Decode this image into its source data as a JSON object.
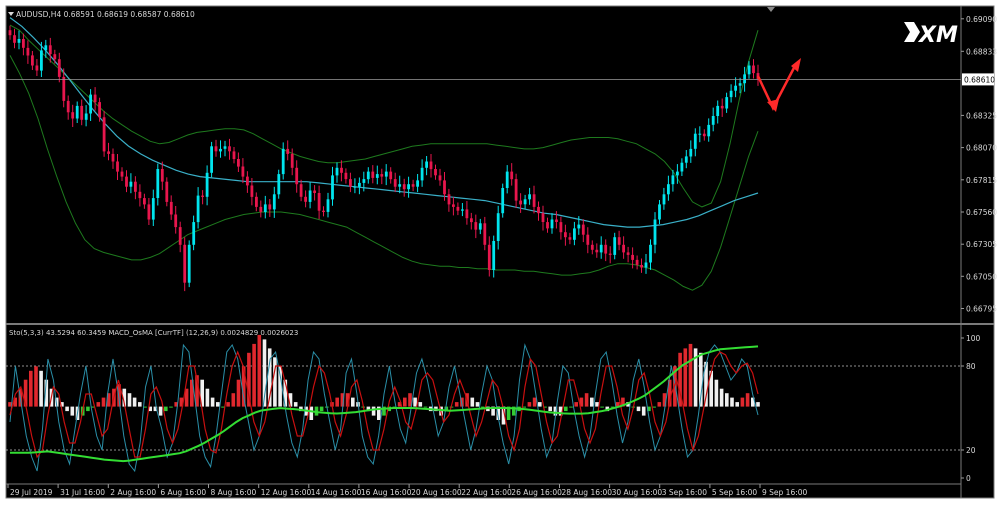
{
  "chart_data": {
    "type": "candlestick",
    "main_panel": {
      "title": "AUDUSD,H4  0.68591 0.68619 0.68587 0.68610",
      "current_price": 0.6861,
      "current_price_label": "0.68610",
      "ylim": [
        0.6672,
        0.6916
      ],
      "y_ticks": [
        "0.69090",
        "0.68833",
        "0.68325",
        "0.68070",
        "0.67815",
        "0.67560",
        "0.67305",
        "0.67050",
        "0.66795"
      ],
      "closes": [
        0.6896,
        0.689,
        0.6893,
        0.6886,
        0.688,
        0.6872,
        0.6868,
        0.6884,
        0.6888,
        0.6881,
        0.6877,
        0.6863,
        0.6844,
        0.6835,
        0.683,
        0.684,
        0.6829,
        0.6834,
        0.6849,
        0.6843,
        0.6831,
        0.6804,
        0.6802,
        0.6796,
        0.6788,
        0.6784,
        0.6776,
        0.678,
        0.6772,
        0.6767,
        0.6762,
        0.675,
        0.6767,
        0.679,
        0.678,
        0.6764,
        0.6754,
        0.6744,
        0.673,
        0.67,
        0.673,
        0.6748,
        0.6769,
        0.6768,
        0.6787,
        0.6808,
        0.6804,
        0.6806,
        0.6808,
        0.6804,
        0.6798,
        0.6792,
        0.6784,
        0.6777,
        0.6768,
        0.676,
        0.6756,
        0.6762,
        0.6758,
        0.677,
        0.6786,
        0.6806,
        0.6802,
        0.6791,
        0.6778,
        0.6768,
        0.6764,
        0.6773,
        0.6771,
        0.6757,
        0.6756,
        0.6766,
        0.6785,
        0.6791,
        0.6787,
        0.6782,
        0.6776,
        0.6776,
        0.6779,
        0.6782,
        0.6788,
        0.6783,
        0.6786,
        0.6784,
        0.6788,
        0.6782,
        0.6776,
        0.6778,
        0.6774,
        0.6778,
        0.6776,
        0.6781,
        0.6791,
        0.6796,
        0.679,
        0.6785,
        0.6781,
        0.677,
        0.6762,
        0.676,
        0.6757,
        0.6758,
        0.6751,
        0.6748,
        0.6742,
        0.6747,
        0.673,
        0.671,
        0.6733,
        0.6755,
        0.6775,
        0.6788,
        0.6782,
        0.6765,
        0.6762,
        0.6766,
        0.677,
        0.676,
        0.6755,
        0.6748,
        0.6743,
        0.675,
        0.6748,
        0.674,
        0.6736,
        0.6734,
        0.6743,
        0.6746,
        0.6738,
        0.673,
        0.6726,
        0.6724,
        0.673,
        0.6723,
        0.6722,
        0.6736,
        0.673,
        0.6724,
        0.6722,
        0.6718,
        0.6714,
        0.6712,
        0.6716,
        0.673,
        0.675,
        0.6762,
        0.677,
        0.6778,
        0.6785,
        0.6788,
        0.6795,
        0.68,
        0.6806,
        0.6818,
        0.6818,
        0.6816,
        0.6825,
        0.6832,
        0.684,
        0.6838,
        0.6847,
        0.6852,
        0.6856,
        0.6858,
        0.6865,
        0.6872,
        0.6866,
        0.6861
      ],
      "bollinger_upper": [
        0.6904,
        0.69,
        0.6892,
        0.6885,
        0.6878,
        0.6871,
        0.6864,
        0.6857,
        0.685,
        0.6843,
        0.6836,
        0.683,
        0.6825,
        0.682,
        0.6816,
        0.6812,
        0.681,
        0.6811,
        0.6814,
        0.6817,
        0.6819,
        0.682,
        0.6821,
        0.6822,
        0.6822,
        0.6821,
        0.6818,
        0.6814,
        0.681,
        0.6806,
        0.6803,
        0.68,
        0.6798,
        0.6796,
        0.6795,
        0.6795,
        0.6796,
        0.6797,
        0.6798,
        0.68,
        0.6802,
        0.6804,
        0.6806,
        0.6808,
        0.6809,
        0.681,
        0.681,
        0.681,
        0.681,
        0.681,
        0.681,
        0.681,
        0.6809,
        0.6808,
        0.6807,
        0.6806,
        0.6806,
        0.6807,
        0.6809,
        0.6811,
        0.6813,
        0.6814,
        0.6815,
        0.6815,
        0.6815,
        0.6814,
        0.6812,
        0.681,
        0.6806,
        0.6802,
        0.6796,
        0.6787,
        0.6775,
        0.6764,
        0.676,
        0.6763,
        0.678,
        0.681,
        0.6845,
        0.6875,
        0.69
      ],
      "bollinger_lower": [
        0.688,
        0.6866,
        0.685,
        0.683,
        0.6806,
        0.6784,
        0.6764,
        0.6747,
        0.6734,
        0.6727,
        0.6724,
        0.6722,
        0.672,
        0.6718,
        0.6718,
        0.672,
        0.6723,
        0.6728,
        0.6733,
        0.6738,
        0.6741,
        0.6744,
        0.6747,
        0.675,
        0.6752,
        0.6754,
        0.6755,
        0.6756,
        0.6756,
        0.6756,
        0.6755,
        0.6754,
        0.6752,
        0.675,
        0.6748,
        0.6746,
        0.6744,
        0.674,
        0.6736,
        0.6732,
        0.6728,
        0.6724,
        0.672,
        0.6717,
        0.6715,
        0.6714,
        0.6713,
        0.6713,
        0.6712,
        0.6712,
        0.6711,
        0.6711,
        0.671,
        0.671,
        0.671,
        0.6709,
        0.6709,
        0.6708,
        0.6707,
        0.6706,
        0.6706,
        0.6707,
        0.6708,
        0.671,
        0.6713,
        0.6715,
        0.6715,
        0.6714,
        0.6712,
        0.671,
        0.6706,
        0.6702,
        0.6697,
        0.6694,
        0.6698,
        0.6709,
        0.6728,
        0.6752,
        0.6776,
        0.68,
        0.682
      ],
      "moving_average": [
        0.691,
        0.6903,
        0.6894,
        0.6884,
        0.6873,
        0.6861,
        0.6849,
        0.6837,
        0.6826,
        0.6816,
        0.6808,
        0.6802,
        0.6797,
        0.6793,
        0.6789,
        0.6786,
        0.6784,
        0.6783,
        0.6782,
        0.6781,
        0.678,
        0.678,
        0.678,
        0.678,
        0.678,
        0.678,
        0.6779,
        0.6778,
        0.6777,
        0.6776,
        0.6775,
        0.6774,
        0.6773,
        0.6772,
        0.6771,
        0.677,
        0.6769,
        0.6768,
        0.6767,
        0.6766,
        0.6765,
        0.6763,
        0.6761,
        0.6759,
        0.6757,
        0.6755,
        0.6754,
        0.6752,
        0.675,
        0.6748,
        0.6746,
        0.6745,
        0.6744,
        0.6744,
        0.6745,
        0.6746,
        0.6748,
        0.675,
        0.6753,
        0.6757,
        0.6761,
        0.6765,
        0.6768,
        0.6771
      ]
    },
    "sub_panel": {
      "label": "Sto(5,3,3) 43.5294 60.3459  MACD_OsMA [CurrTF] (12,26,9) 0.0024829 0.0026023",
      "ylim": [
        0,
        100
      ],
      "levels": [
        {
          "value": 100,
          "label": "100",
          "line": false
        },
        {
          "value": 80,
          "label": "80",
          "line": true
        },
        {
          "value": 20,
          "label": "20",
          "line": true
        },
        {
          "value": 0,
          "label": "0",
          "line": false
        }
      ],
      "sto_k": [
        40,
        80,
        55,
        30,
        15,
        5,
        35,
        85,
        70,
        40,
        20,
        10,
        35,
        60,
        80,
        50,
        30,
        20,
        60,
        85,
        60,
        30,
        10,
        5,
        25,
        65,
        80,
        50,
        35,
        15,
        25,
        55,
        95,
        90,
        60,
        30,
        15,
        8,
        30,
        60,
        90,
        95,
        85,
        60,
        40,
        20,
        30,
        60,
        85,
        90,
        70,
        45,
        25,
        15,
        35,
        70,
        90,
        85,
        60,
        40,
        20,
        35,
        75,
        85,
        60,
        30,
        15,
        10,
        30,
        60,
        80,
        55,
        35,
        25,
        50,
        75,
        85,
        70,
        50,
        30,
        40,
        65,
        80,
        60,
        40,
        20,
        35,
        60,
        80,
        70,
        45,
        25,
        10,
        30,
        70,
        95,
        85,
        60,
        35,
        15,
        25,
        55,
        80,
        75,
        50,
        30,
        15,
        30,
        60,
        85,
        90,
        70,
        45,
        25,
        40,
        70,
        85,
        65,
        40,
        20,
        30,
        55,
        80,
        60,
        35,
        15,
        20,
        45,
        75,
        90,
        95,
        90,
        80,
        70,
        75,
        85,
        80,
        60,
        45
      ],
      "sto_d": [
        45,
        60,
        65,
        50,
        30,
        15,
        20,
        45,
        65,
        60,
        40,
        25,
        25,
        40,
        60,
        60,
        45,
        30,
        35,
        55,
        70,
        55,
        35,
        15,
        15,
        35,
        60,
        65,
        55,
        35,
        25,
        35,
        55,
        80,
        80,
        60,
        35,
        20,
        18,
        35,
        60,
        80,
        90,
        80,
        60,
        40,
        30,
        40,
        60,
        80,
        80,
        65,
        45,
        30,
        30,
        45,
        65,
        80,
        75,
        60,
        40,
        30,
        45,
        65,
        70,
        55,
        35,
        20,
        20,
        35,
        55,
        65,
        55,
        40,
        35,
        50,
        70,
        75,
        70,
        55,
        40,
        45,
        60,
        70,
        60,
        45,
        30,
        40,
        55,
        70,
        65,
        50,
        30,
        20,
        35,
        65,
        85,
        80,
        60,
        40,
        25,
        30,
        50,
        70,
        70,
        55,
        35,
        25,
        35,
        60,
        80,
        80,
        65,
        45,
        35,
        50,
        70,
        75,
        60,
        40,
        30,
        40,
        60,
        70,
        55,
        35,
        20,
        30,
        50,
        70,
        85,
        90,
        88,
        80,
        75,
        80,
        82,
        75,
        60
      ],
      "macd_signal_level": 60,
      "osma": [
        1,
        2,
        4,
        6,
        8,
        9,
        8,
        6,
        4,
        2,
        1,
        -1,
        -2,
        -3,
        -2,
        -1,
        0,
        1,
        2,
        3,
        4,
        5,
        4,
        3,
        2,
        1,
        0,
        -1,
        -1,
        -2,
        -1,
        0,
        1,
        2,
        4,
        6,
        7,
        6,
        4,
        2,
        1,
        0,
        1,
        3,
        6,
        9,
        12,
        14,
        16,
        15,
        13,
        11,
        9,
        6,
        3,
        1,
        -1,
        -2,
        -3,
        -2,
        -1,
        0,
        1,
        2,
        3,
        3,
        2,
        1,
        0,
        -1,
        -2,
        -3,
        -2,
        -1,
        0,
        1,
        2,
        3,
        2,
        1,
        0,
        -1,
        -1,
        -2,
        -1,
        0,
        1,
        2,
        3,
        2,
        1,
        0,
        -1,
        -2,
        -3,
        -4,
        -3,
        -2,
        -1,
        0,
        1,
        2,
        1,
        0,
        -1,
        -2,
        -2,
        -1,
        0,
        1,
        2,
        3,
        2,
        1,
        0,
        -1,
        0,
        1,
        2,
        1,
        0,
        -1,
        -2,
        -1,
        0,
        1,
        3,
        6,
        9,
        12,
        13,
        14,
        13,
        12,
        10,
        8,
        6,
        4,
        3,
        2,
        1,
        2,
        3,
        2,
        1
      ]
    },
    "x_ticks": [
      "29 Jul 2019",
      "31 Jul 16:00",
      "2 Aug 16:00",
      "6 Aug 16:00",
      "8 Aug 16:00",
      "12 Aug 16:00",
      "14 Aug 16:00",
      "16 Aug 16:00",
      "20 Aug 16:00",
      "22 Aug 16:00",
      "26 Aug 16:00",
      "28 Aug 16:00",
      "30 Aug 16:00",
      "3 Sep 16:00",
      "5 Sep 16:00",
      "9 Sep 16:00"
    ],
    "grid": false,
    "colors": {
      "background": "#000000",
      "bull": "#00e5ee",
      "bear": "#e8164d",
      "band": "#1e7a1e",
      "ma": "#3ab0c8",
      "sto_k": "#2a8fa8",
      "sto_d": "#c81010",
      "macd_signal": "#33dd33",
      "osma_up": "#e0282e",
      "osma_down": "#f0f0f0",
      "osma_neutral": "#33cc33",
      "text": "#d8d8d8",
      "arrow": "#ff2a2a"
    }
  },
  "brand": {
    "logo_text": "XM"
  }
}
